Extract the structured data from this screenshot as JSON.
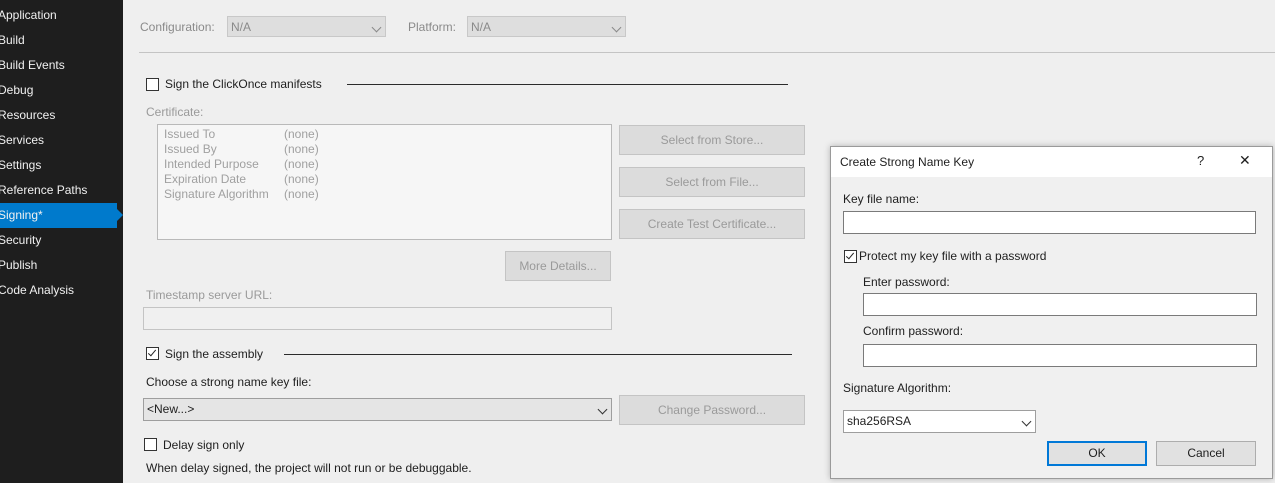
{
  "sidebar": {
    "items": [
      {
        "label": "Application"
      },
      {
        "label": "Build"
      },
      {
        "label": "Build Events"
      },
      {
        "label": "Debug"
      },
      {
        "label": "Resources"
      },
      {
        "label": "Services"
      },
      {
        "label": "Settings"
      },
      {
        "label": "Reference Paths"
      },
      {
        "label": "Signing*"
      },
      {
        "label": "Security"
      },
      {
        "label": "Publish"
      },
      {
        "label": "Code Analysis"
      }
    ],
    "active_index": 8
  },
  "config_bar": {
    "configuration_label": "Configuration:",
    "configuration_value": "N/A",
    "platform_label": "Platform:",
    "platform_value": "N/A"
  },
  "clickonce": {
    "checkbox_label": "Sign the ClickOnce manifests",
    "checked": false,
    "certificate_label": "Certificate:",
    "rows": [
      {
        "key": "Issued To",
        "value": "(none)"
      },
      {
        "key": "Issued By",
        "value": "(none)"
      },
      {
        "key": "Intended Purpose",
        "value": "(none)"
      },
      {
        "key": "Expiration Date",
        "value": "(none)"
      },
      {
        "key": "Signature Algorithm",
        "value": "(none)"
      }
    ],
    "select_from_store": "Select from Store...",
    "select_from_file": "Select from File...",
    "create_test_certificate": "Create Test Certificate...",
    "more_details": "More Details...",
    "timestamp_label": "Timestamp server URL:",
    "timestamp_value": ""
  },
  "assembly": {
    "checkbox_label": "Sign the assembly",
    "checked": true,
    "choose_label": "Choose a strong name key file:",
    "key_file_value": "<New...>",
    "change_password": "Change Password...",
    "delay_sign_label": "Delay sign only",
    "delay_sign_checked": false,
    "delay_note": "When delay signed, the project will not run or be debuggable."
  },
  "dialog": {
    "title": "Create Strong Name Key",
    "help_glyph": "?",
    "close_glyph": "✕",
    "key_file_label": "Key file name:",
    "key_file_value": "",
    "protect_label": "Protect my key file with a password",
    "protect_checked": true,
    "enter_password_label": "Enter password:",
    "confirm_password_label": "Confirm password:",
    "signature_algorithm_label": "Signature Algorithm:",
    "signature_algorithm_value": "sha256RSA",
    "ok": "OK",
    "cancel": "Cancel"
  }
}
